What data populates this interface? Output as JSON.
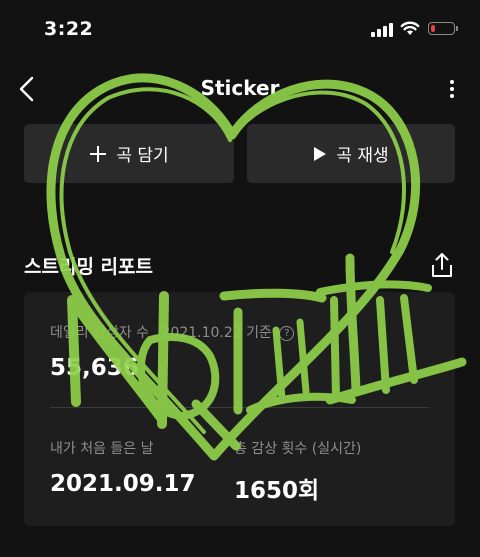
{
  "status_bar": {
    "time": "3:22",
    "battery_color": "#e0463e",
    "battery_level": 0.2
  },
  "nav": {
    "title": "Sticker"
  },
  "actions": {
    "add_label": "곡 담기",
    "play_label": "곡 재생"
  },
  "report": {
    "title": "스트리밍 리포트",
    "daily_listeners_label": "데일리 감상자 수",
    "date_basis": "2021.10.22 기준",
    "daily_listeners_value": "55,636",
    "first_listen_label": "내가 처음 들은 날",
    "first_listen_value": "2021.09.17",
    "total_plays_label": "총 감상 횟수 (실시간)",
    "total_plays_value": "1650회"
  },
  "overlay": {
    "scribble_text": "NCT",
    "stroke_color": "#8ed04a"
  }
}
